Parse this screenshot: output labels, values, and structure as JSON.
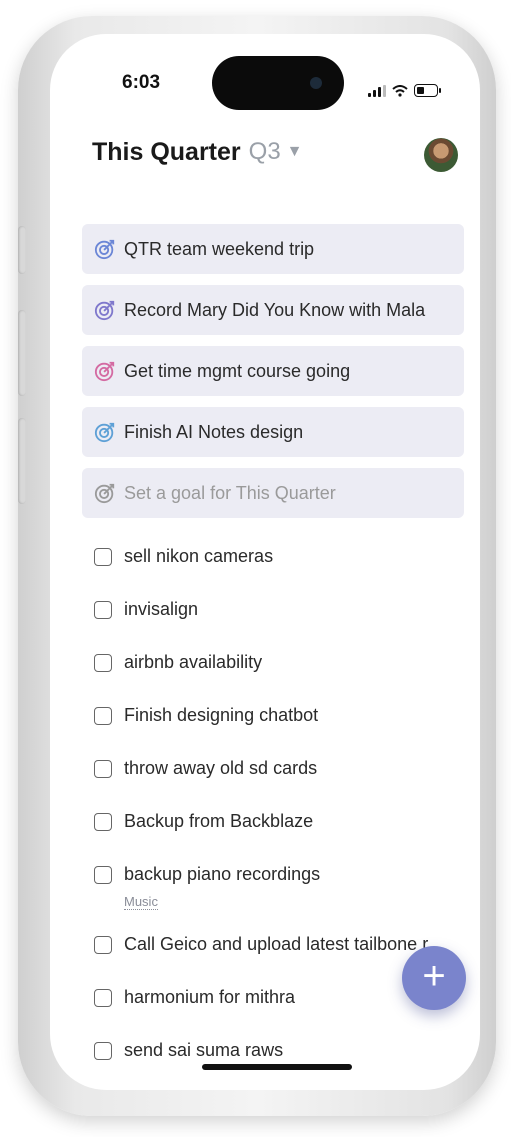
{
  "status": {
    "time": "6:03"
  },
  "header": {
    "title": "This Quarter",
    "period": "Q3",
    "caret": "▼"
  },
  "goals": [
    {
      "label": "QTR team weekend trip",
      "color": "#6b86d6"
    },
    {
      "label": "Record Mary Did You Know with Mala",
      "color": "#7f78cc"
    },
    {
      "label": "Get time mgmt course going",
      "color": "#d46aa2"
    },
    {
      "label": "Finish AI Notes design",
      "color": "#5ea0d6"
    },
    {
      "label": "Set a goal for This Quarter",
      "color": "#9a9a9a"
    }
  ],
  "tasks": [
    {
      "label": "sell nikon cameras"
    },
    {
      "label": "invisalign"
    },
    {
      "label": "airbnb availability"
    },
    {
      "label": "Finish designing chatbot"
    },
    {
      "label": "throw away old sd cards"
    },
    {
      "label": "Backup from Backblaze"
    },
    {
      "label": "backup piano recordings",
      "tag": "Music"
    },
    {
      "label": "Call Geico and upload latest tailbone r"
    },
    {
      "label": "harmonium for mithra"
    },
    {
      "label": "send sai suma raws"
    }
  ],
  "fab": {
    "icon": "+"
  }
}
